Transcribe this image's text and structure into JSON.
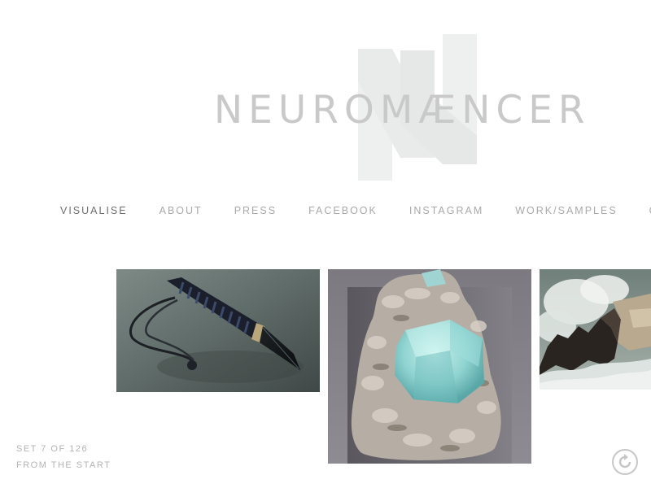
{
  "logo": {
    "text": "NEUROMÆNCER",
    "icon": "nn-logo-mark-icon"
  },
  "nav": {
    "items": [
      {
        "label": "VISUALISE",
        "active": true
      },
      {
        "label": "ABOUT",
        "active": false
      },
      {
        "label": "PRESS",
        "active": false
      },
      {
        "label": "FACEBOOK",
        "active": false
      },
      {
        "label": "INSTAGRAM",
        "active": false
      },
      {
        "label": "WORK/SAMPLES",
        "active": false
      },
      {
        "label": "C",
        "active": false
      }
    ]
  },
  "gallery": {
    "photos": [
      {
        "subject": "paracord-wrapped-knife"
      },
      {
        "subject": "aquamarine-crystal-on-mineral"
      },
      {
        "subject": "ocean-wave-on-rocks"
      }
    ]
  },
  "set_info": {
    "set_label": "SET 7 OF 126",
    "from_start": "FROM THE START"
  },
  "icons": {
    "restart": "restart-icon"
  },
  "colors": {
    "nav_text": "#a9a9a9",
    "nav_active": "#6f6f6f",
    "logo_text": "#c9c9c9",
    "logo_mark": "#eef0ef",
    "set_info_text": "#b3b3b3"
  }
}
